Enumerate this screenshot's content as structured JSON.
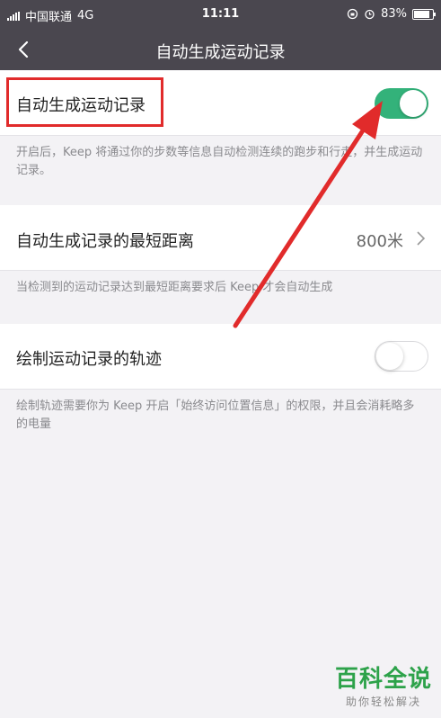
{
  "status_bar": {
    "carrier": "中国联通",
    "network": "4G",
    "time": "11:11",
    "battery": "83%",
    "battery_level": 0.83
  },
  "nav": {
    "back_icon": "chevron-left-icon",
    "title": "自动生成运动记录"
  },
  "settings": {
    "auto_record": {
      "label": "自动生成运动记录",
      "enabled": true,
      "description": "开启后，Keep 将通过你的步数等信息自动检测连续的跑步和行走，并生成运动记录。"
    },
    "min_distance": {
      "label": "自动生成记录的最短距离",
      "value": "800米",
      "description": "当检测到的运动记录达到最短距离要求后 Keep 才会自动生成"
    },
    "draw_track": {
      "label": "绘制运动记录的轨迹",
      "enabled": false,
      "description": "绘制轨迹需要你为 Keep 开启「始终访问位置信息」的权限，并且会消耗略多的电量"
    }
  },
  "colors": {
    "header_bg": "#4a474f",
    "toggle_on": "#33b27a",
    "annotation_red": "#e12b2b",
    "watermark_green": "#2da24a"
  },
  "watermark": {
    "title": "百科全说",
    "subtitle": "助你轻松解决"
  }
}
